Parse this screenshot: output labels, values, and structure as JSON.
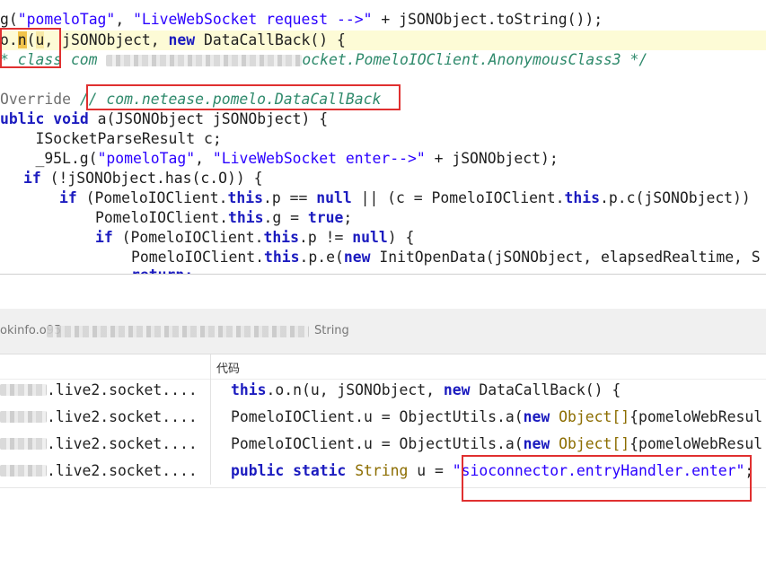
{
  "editor": {
    "l1": {
      "a": "g(",
      "s1": "\"pomeloTag\"",
      "b": ", ",
      "s2": "\"LiveWebSocket request -->\"",
      "c": " + jSONObject.toString());"
    },
    "l2": {
      "a": "o.",
      "method": "n",
      "b": "(",
      "arg": "u",
      "c": ", jSONObject, ",
      "kw_new": "new",
      "d": " DataCallBack() {"
    },
    "l3": {
      "c1": "* class com ",
      "c2": "ocket.PomeloIOClient.AnonymousClass3 */"
    },
    "l5": {
      "ann": "Override ",
      "cmt": "// com.netease.pomelo.DataCallBack"
    },
    "l6": {
      "kw1": "ublic",
      "kw2": "void",
      "rest": " a(JSONObject jSONObject) {"
    },
    "l7": "    ISocketParseResult c;",
    "l8": {
      "a": "    _95L.g(",
      "s1": "\"pomeloTag\"",
      "b": ", ",
      "s2": "\"LiveWebSocket enter-->\"",
      "c": " + jSONObject);"
    },
    "l9": {
      "kw_if": "if",
      "rest": " (!jSONObject.has(c.O)) {"
    },
    "l10": {
      "kw_if": "if",
      "a": " (PomeloIOClient.",
      "kw_this1": "this",
      "b": ".p == ",
      "kw_null": "null",
      "c": " || (c = PomeloIOClient.",
      "kw_this2": "this",
      "d": ".p.c(jSONObject))"
    },
    "l11": {
      "a": "PomeloIOClient.",
      "kw_this": "this",
      "b": ".g = ",
      "kw_true": "true",
      "c": ";"
    },
    "l12": {
      "kw_if": "if",
      "a": " (PomeloIOClient.",
      "kw_this": "this",
      "b": ".p != ",
      "kw_null": "null",
      "c": ") {"
    },
    "l13": {
      "a": "PomeloIOClient.",
      "kw_this": "this",
      "b": ".p.e(",
      "kw_new": "new",
      "c": " InitOpenData(jSONObject, elapsedRealtime, S"
    },
    "l14": "return;"
  },
  "results": {
    "header": {
      "prefix": "okinfo.o95",
      "type_label": "String"
    },
    "columns": {
      "location": "",
      "code": "代码"
    },
    "rows": [
      {
        "location": ".live2.socket....",
        "code": {
          "kw_this": "this",
          "a": ".o.n(u, jSONObject, ",
          "kw_new": "new",
          "b": " DataCallBack() {"
        }
      },
      {
        "location": ".live2.socket....",
        "code": {
          "a": "PomeloIOClient.u = ObjectUtils.a(",
          "kw_new": "new",
          "type": "Object[]",
          "b": "{pomeloWebResul"
        }
      },
      {
        "location": ".live2.socket....",
        "code": {
          "a": "PomeloIOClient.u = ObjectUtils.a(",
          "kw_new": "new",
          "type": "Object[]",
          "b": "{pomeloWebResul"
        }
      },
      {
        "location": ".live2.socket....",
        "code": {
          "kw_public": "public",
          "kw_static": "static",
          "type": "String",
          "a": " u = ",
          "str": "\"sioconnector.entryHandler.enter\"",
          "b": ";"
        }
      }
    ]
  },
  "colors": {
    "keyword": "#1b1bbf",
    "string": "#2a00ff",
    "comment": "#2f8a6c",
    "type": "#8c6d00",
    "highlight_row": "#fdfbd6",
    "annotation_box": "#e03030"
  }
}
